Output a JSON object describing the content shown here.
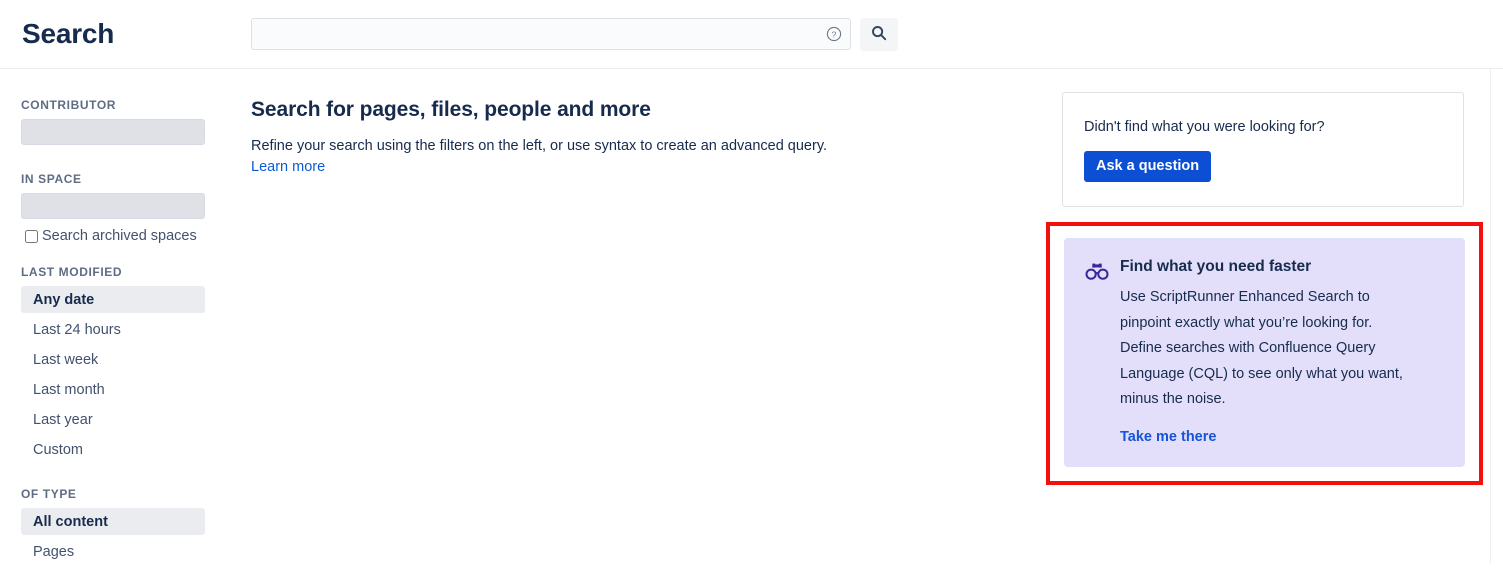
{
  "header": {
    "title": "Search",
    "search_value": "",
    "search_placeholder": "",
    "help_icon": "question-circle-icon",
    "submit_icon": "search-icon"
  },
  "sidebar": {
    "groups": [
      {
        "label": "CONTRIBUTOR",
        "field_value": "",
        "field_placeholder": ""
      },
      {
        "label": "IN SPACE",
        "field_value": "",
        "field_placeholder": "",
        "checkbox_label": "Search archived spaces",
        "checkbox_checked": false
      },
      {
        "label": "LAST MODIFIED",
        "options": [
          {
            "label": "Any date",
            "selected": true
          },
          {
            "label": "Last 24 hours",
            "selected": false
          },
          {
            "label": "Last week",
            "selected": false
          },
          {
            "label": "Last month",
            "selected": false
          },
          {
            "label": "Last year",
            "selected": false
          },
          {
            "label": "Custom",
            "selected": false
          }
        ]
      },
      {
        "label": "OF TYPE",
        "options": [
          {
            "label": "All content",
            "selected": true
          },
          {
            "label": "Pages",
            "selected": false
          }
        ]
      }
    ]
  },
  "main": {
    "heading": "Search for pages, files, people and more",
    "description": "Refine your search using the filters on the left, or use syntax to create an advanced query.",
    "learn_more": "Learn more"
  },
  "right_rail": {
    "ask_card": {
      "text": "Didn't find what you were looking for?",
      "button_label": "Ask a question"
    },
    "promo": {
      "icon": "binoculars-icon",
      "title": "Find what you need faster",
      "body": "Use ScriptRunner Enhanced Search to pinpoint exactly what you’re looking for. Define searches with Confluence Query Language (CQL) to see only what you want, minus the noise.",
      "link": "Take me there",
      "highlight_color": "#F40F0F",
      "background_color": "#E3DFFB"
    }
  },
  "colors": {
    "text_primary": "#172B4D",
    "text_subtle": "#5E6C84",
    "link_blue": "#0C5BD6",
    "button_blue": "#0C4FD4",
    "selected_row": "#EBECF0",
    "field_gray": "#DFE1E6",
    "highlight_red": "#F40F0F",
    "promo_lavender": "#E3DFFB",
    "icon_indigo": "#38269B"
  }
}
